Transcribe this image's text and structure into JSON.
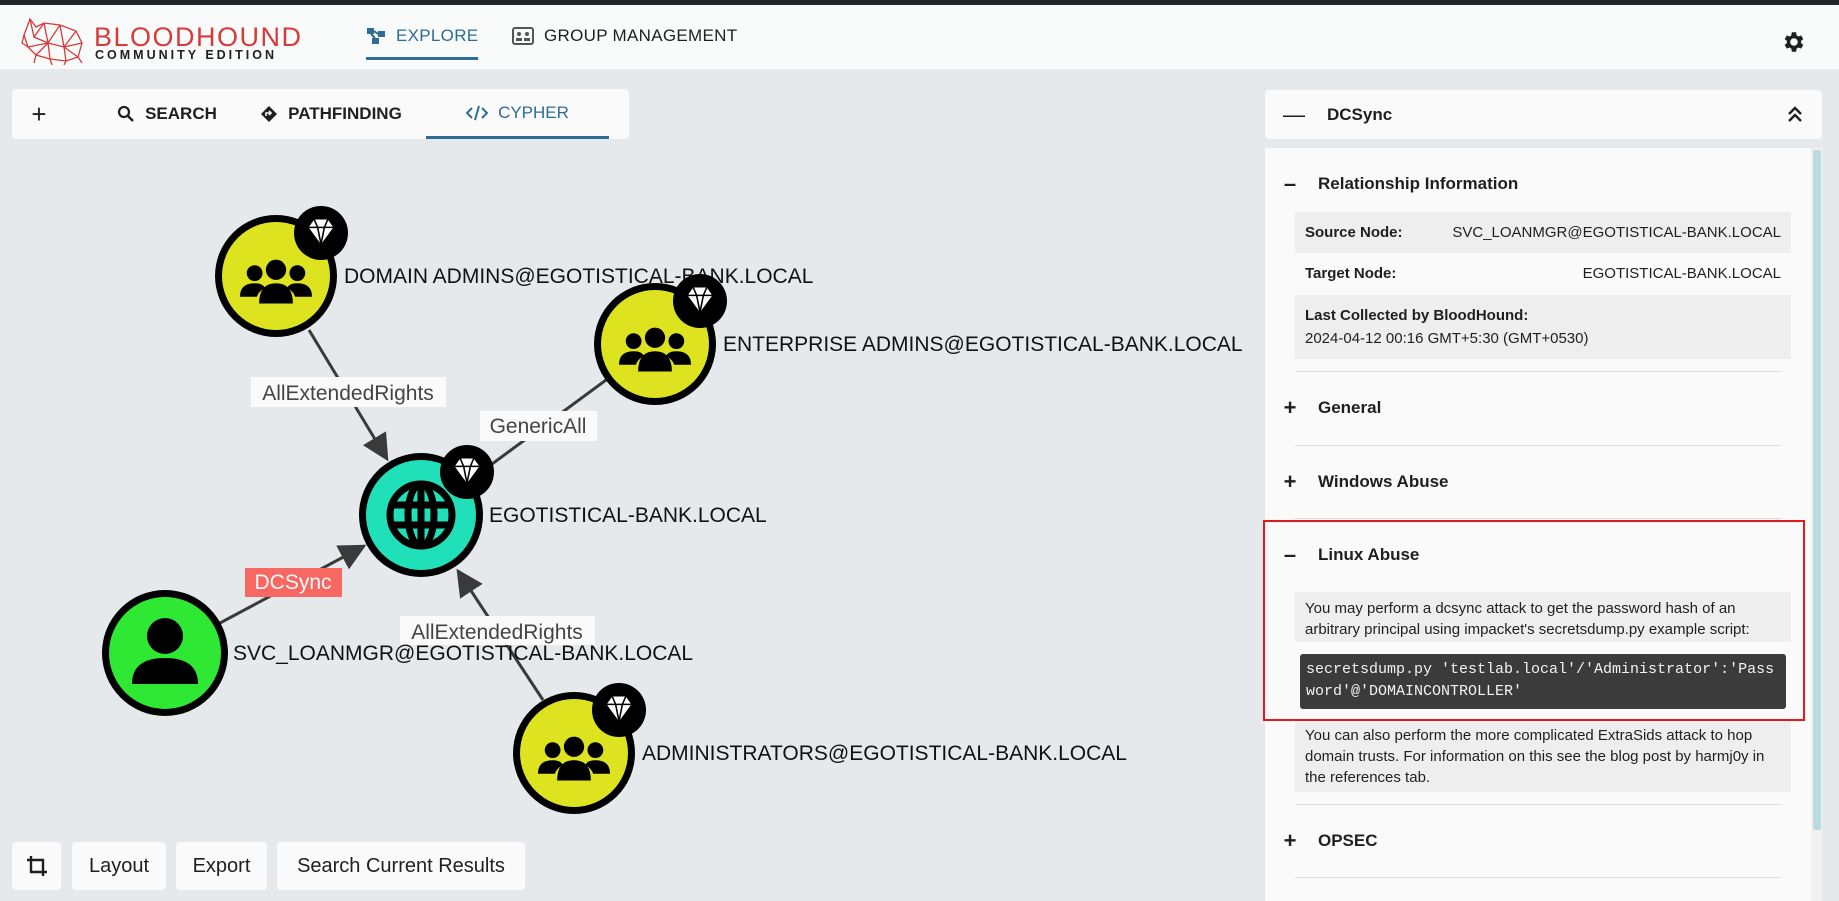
{
  "header": {
    "brand_line1": "BLOODHOUND",
    "brand_line2": "COMMUNITY EDITION",
    "nav": [
      {
        "label": "EXPLORE",
        "icon": "explore-icon",
        "active": true
      },
      {
        "label": "GROUP MANAGEMENT",
        "icon": "group-management-icon",
        "active": false
      }
    ],
    "settings_icon": "gear-icon",
    "accent_color": "#2e6b95",
    "brand_color": "#d63b39"
  },
  "search_tabs": {
    "add_label": "+",
    "tabs": [
      {
        "label": "SEARCH",
        "icon": "search-icon"
      },
      {
        "label": "PATHFINDING",
        "icon": "pathfinding-icon"
      },
      {
        "label": "CYPHER",
        "icon": "code-icon",
        "active": true
      }
    ]
  },
  "graph": {
    "nodes": [
      {
        "id": "domain-admins",
        "label": "DOMAIN ADMINS@EGOTISTICAL-BANK.LOCAL",
        "kind": "group",
        "color": "#dde31f",
        "tier_zero": true
      },
      {
        "id": "enterprise-admins",
        "label": "ENTERPRISE ADMINS@EGOTISTICAL-BANK.LOCAL",
        "kind": "group",
        "color": "#dde31f",
        "tier_zero": true
      },
      {
        "id": "domain",
        "label": "EGOTISTICAL-BANK.LOCAL",
        "kind": "domain",
        "color": "#1fe0b8",
        "tier_zero": true
      },
      {
        "id": "svc-loanmgr",
        "label": "SVC_LOANMGR@EGOTISTICAL-BANK.LOCAL",
        "kind": "user",
        "color": "#2ee833",
        "tier_zero": false
      },
      {
        "id": "administrators",
        "label": "ADMINISTRATORS@EGOTISTICAL-BANK.LOCAL",
        "kind": "group",
        "color": "#dde31f",
        "tier_zero": true
      }
    ],
    "edges": [
      {
        "from": "domain-admins",
        "to": "domain",
        "label": "AllExtendedRights",
        "highlight": false
      },
      {
        "from": "enterprise-admins",
        "to": "domain",
        "label": "GenericAll",
        "highlight": false
      },
      {
        "from": "svc-loanmgr",
        "to": "domain",
        "label": "DCSync",
        "highlight": true
      },
      {
        "from": "administrators",
        "to": "domain",
        "label": "AllExtendedRights",
        "highlight": false
      }
    ],
    "highlight_color": "#f76863"
  },
  "bottom": {
    "crop_icon": "crop-icon",
    "layout": "Layout",
    "export": "Export",
    "search_results": "Search Current Results"
  },
  "panel": {
    "title": "DCSync",
    "relationship": {
      "heading": "Relationship Information",
      "source_key": "Source Node:",
      "source_val": "SVC_LOANMGR@EGOTISTICAL-BANK.LOCAL",
      "target_key": "Target Node:",
      "target_val": "EGOTISTICAL-BANK.LOCAL",
      "collected_key": "Last Collected by BloodHound:",
      "collected_val": "2024-04-12 00:16 GMT+5:30 (GMT+0530)"
    },
    "general": "General",
    "windows_abuse": "Windows Abuse",
    "linux_abuse": {
      "heading": "Linux Abuse",
      "intro": "You may perform a dcsync attack to get the password hash of an arbitrary principal using impacket's secretsdump.py example script:",
      "code": "secretsdump.py 'testlab.local'/'Administrator':'Password'@'DOMAINCONTROLLER'",
      "extra": "You can also perform the more complicated ExtraSids attack to hop domain trusts. For information on this see the blog post by harmj0y in the references tab."
    },
    "opsec": "OPSEC"
  }
}
